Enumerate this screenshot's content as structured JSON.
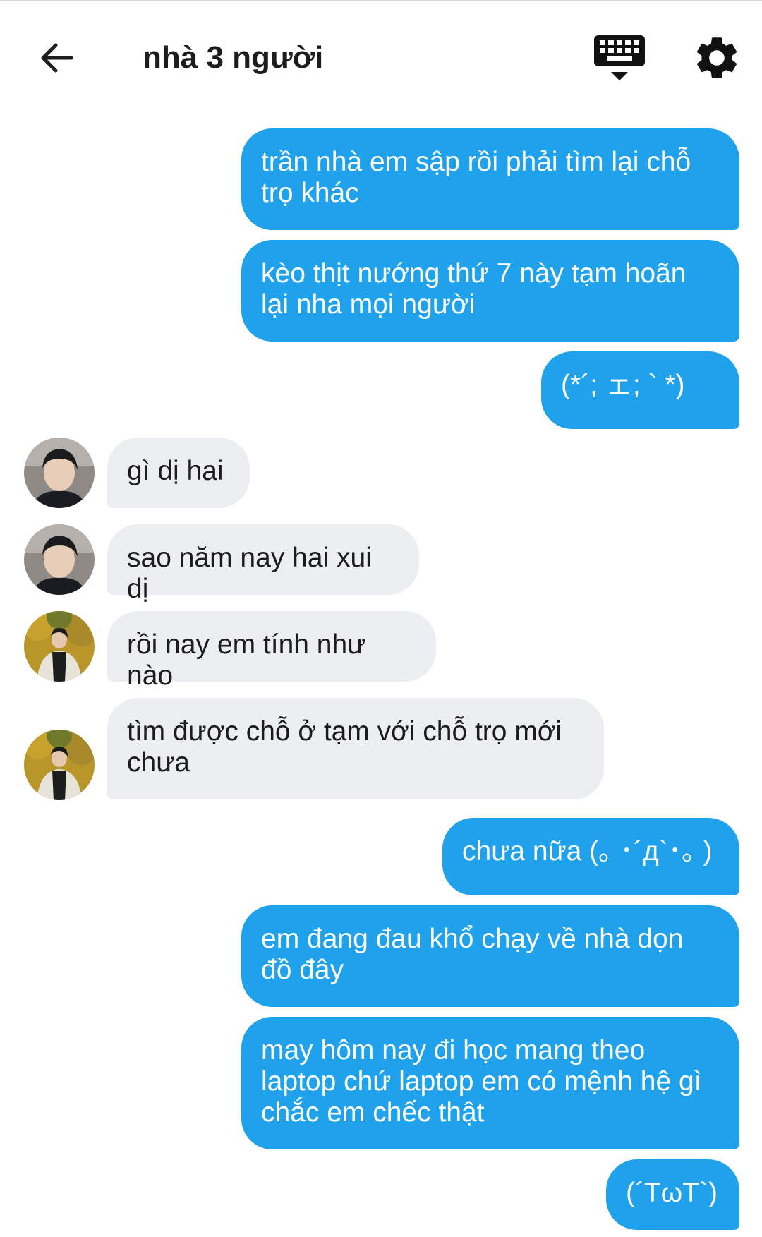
{
  "header": {
    "title": "nhà 3 người",
    "back_icon": "arrow-left-icon",
    "keyboard_icon": "keyboard-hide-icon",
    "settings_icon": "gear-icon"
  },
  "colors": {
    "outgoing_bubble": "#1fa1ec",
    "incoming_bubble": "#eceef1"
  },
  "messages": [
    {
      "dir": "out",
      "text": "trần nhà em sập rồi phải tìm lại chỗ\ntrọ khác"
    },
    {
      "dir": "out",
      "text": "kèo thịt nướng thứ 7 này tạm hoãn\nlại nha mọi người"
    },
    {
      "dir": "out",
      "text": "(*´; ェ; ` *)"
    },
    {
      "dir": "in",
      "sender": "avatar-a",
      "text": "gì dị hai"
    },
    {
      "dir": "in",
      "sender": "avatar-a",
      "text": "sao năm nay hai xui dị"
    },
    {
      "dir": "in",
      "sender": "avatar-b",
      "text": "rồi nay em tính như nào"
    },
    {
      "dir": "in",
      "sender": "avatar-b",
      "text": "tìm được chỗ ở tạm với chỗ trọ mới\nchưa"
    },
    {
      "dir": "out",
      "text": "chưa nữa (｡ ･´д`･｡ )"
    },
    {
      "dir": "out",
      "text": "em đang đau khổ chạy về nhà dọn\nđồ đây"
    },
    {
      "dir": "out",
      "text": "may hôm nay đi học mang theo\nlaptop chứ laptop em có mệnh hệ gì\nchắc em chếc thật"
    },
    {
      "dir": "out",
      "text": "(´TωT`)"
    }
  ]
}
